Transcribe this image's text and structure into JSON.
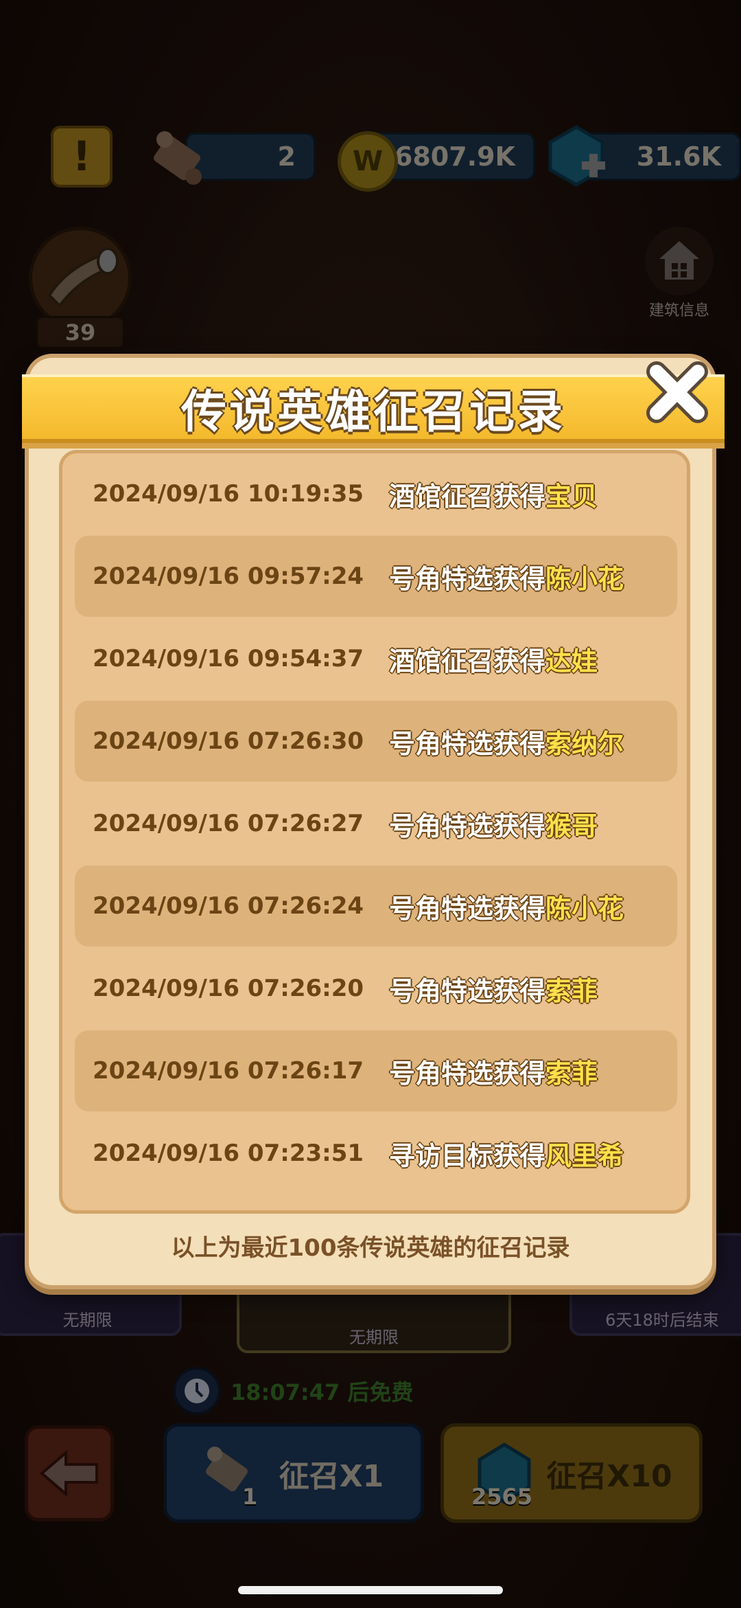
{
  "resources": {
    "scrolls": "2",
    "coins": "6807.9K",
    "gems": "31.6K"
  },
  "horn_count": "39",
  "building_info_label": "建筑信息",
  "banners": [
    {
      "period": "无期限"
    },
    {
      "period": "无期限"
    },
    {
      "period": "6天18时后结束"
    }
  ],
  "free_timer": "18:07:47 后免费",
  "buttons": {
    "summon_x1": "征召X1",
    "summon_x1_cost": "1",
    "summon_x10": "征召X10",
    "summon_x10_cost": "2565"
  },
  "modal": {
    "title": "传说英雄征召记录",
    "footer": "以上为最近100条传说英雄的征召记录",
    "records": [
      {
        "time": "2024/09/16 10:19:35",
        "action": "酒馆征召获得",
        "hero": "宝贝"
      },
      {
        "time": "2024/09/16 09:57:24",
        "action": "号角特选获得",
        "hero": "陈小花"
      },
      {
        "time": "2024/09/16 09:54:37",
        "action": "酒馆征召获得",
        "hero": "达娃"
      },
      {
        "time": "2024/09/16 07:26:30",
        "action": "号角特选获得",
        "hero": "索纳尔"
      },
      {
        "time": "2024/09/16 07:26:27",
        "action": "号角特选获得",
        "hero": "猴哥"
      },
      {
        "time": "2024/09/16 07:26:24",
        "action": "号角特选获得",
        "hero": "陈小花"
      },
      {
        "time": "2024/09/16 07:26:20",
        "action": "号角特选获得",
        "hero": "索菲"
      },
      {
        "time": "2024/09/16 07:26:17",
        "action": "号角特选获得",
        "hero": "索菲"
      },
      {
        "time": "2024/09/16 07:23:51",
        "action": "寻访目标获得",
        "hero": "风里希"
      }
    ]
  },
  "colors": {
    "hero_highlight": "#ffe04a",
    "title_banner": "#f4b92d",
    "panel_bg": "#e9c28f"
  }
}
